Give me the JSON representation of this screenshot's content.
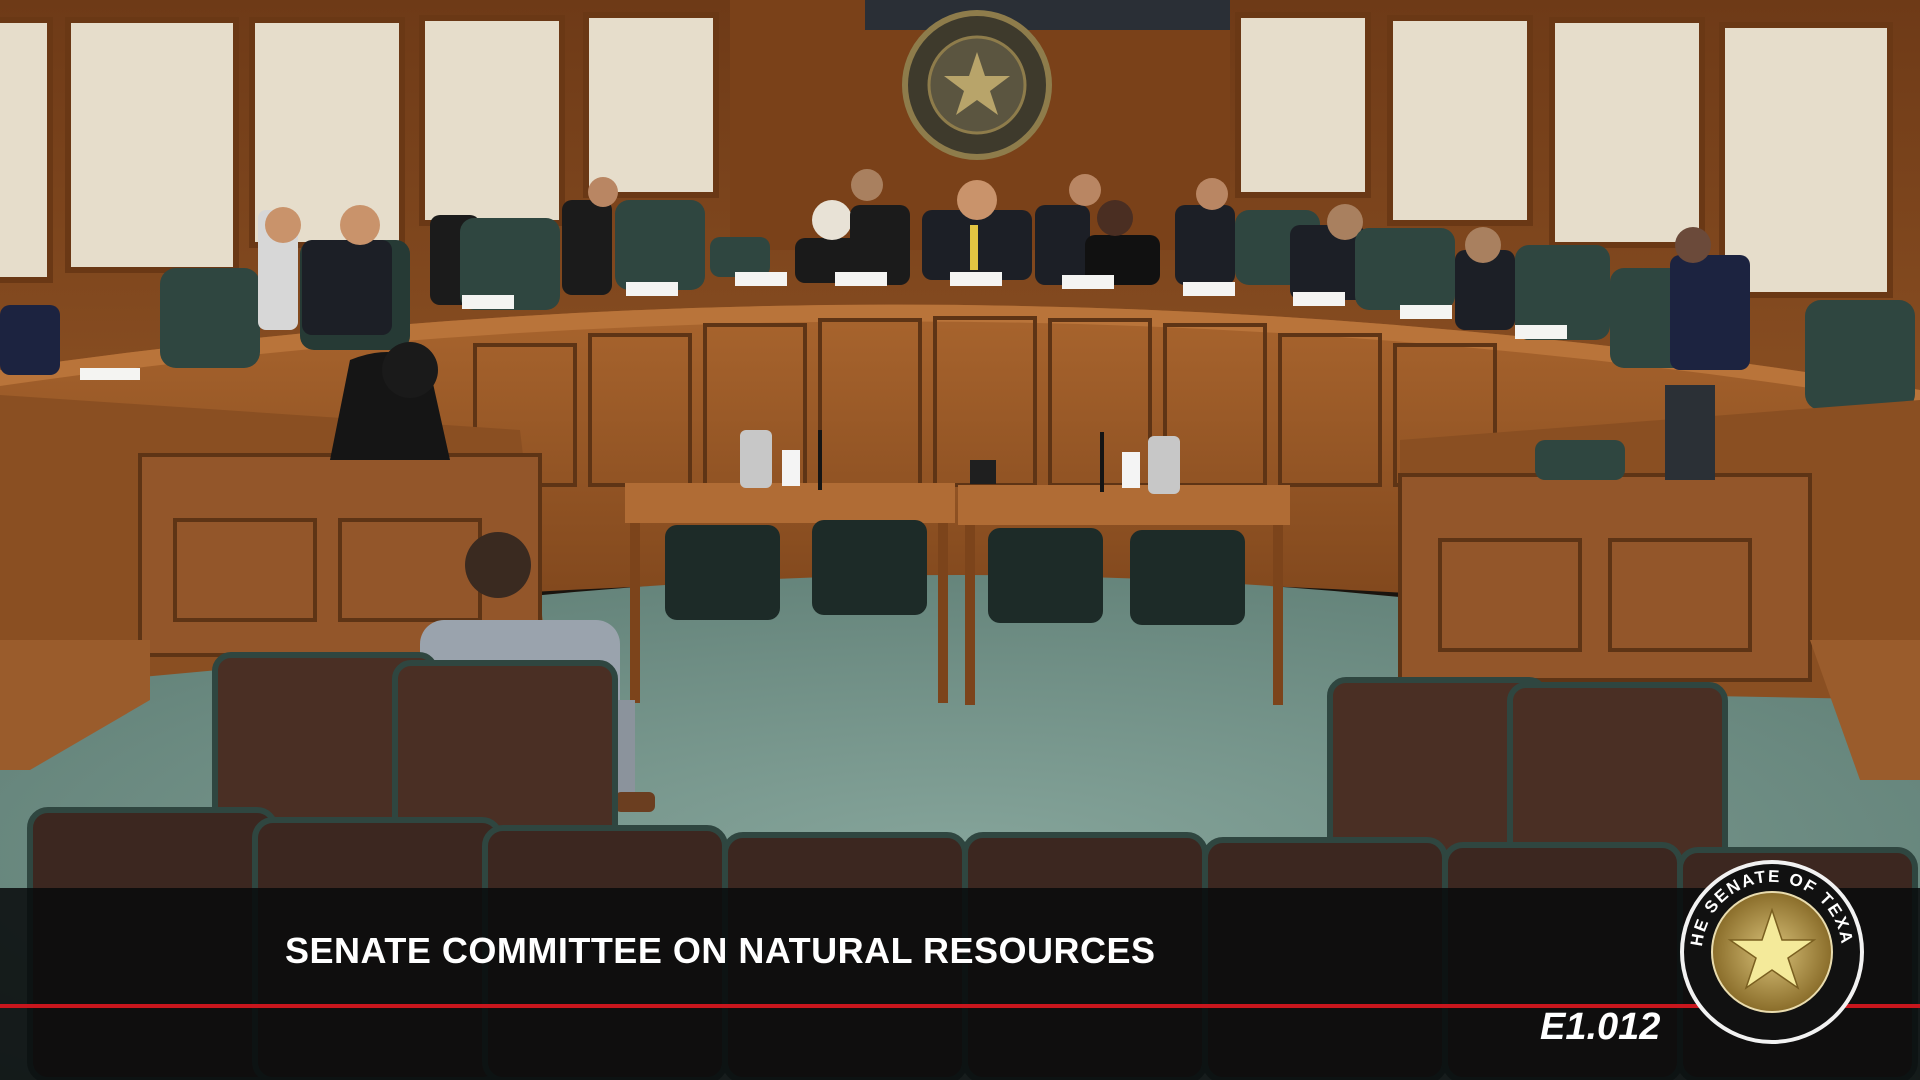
{
  "broadcast": {
    "committee_title": "SENATE COMMITTEE ON NATURAL RESOURCES",
    "room_number": "E1.012",
    "seal_text": "THE SENATE OF TEXAS"
  },
  "scene": {
    "nameplates_count_visible": 14
  },
  "colors": {
    "wood": "#8a4f22",
    "wood_dark": "#5a3213",
    "wall_panel": "#e6ddcb",
    "carpet": "#6f8f86",
    "chair_leather": "#2f4640",
    "overlay": "#0a0c0e",
    "accent_red": "#c8161d",
    "seal_gold": "#b89a4a"
  }
}
